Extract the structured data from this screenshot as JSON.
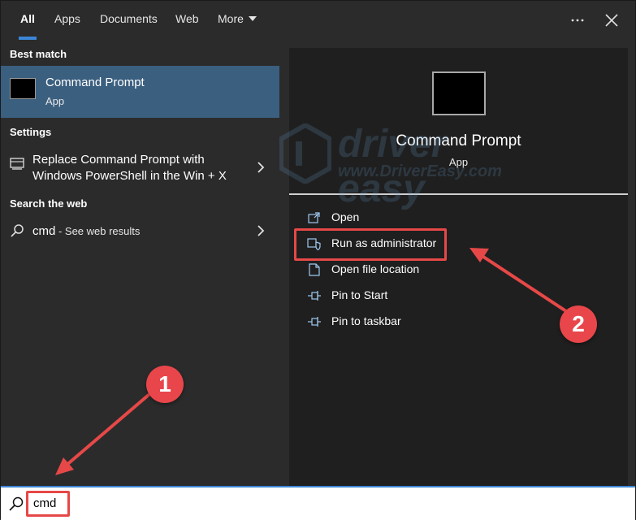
{
  "tabs": [
    {
      "label": "All",
      "active": true
    },
    {
      "label": "Apps"
    },
    {
      "label": "Documents"
    },
    {
      "label": "Web"
    },
    {
      "label": "More"
    }
  ],
  "top_icons": {
    "more": "ellipsis-icon",
    "close": "close-icon"
  },
  "left": {
    "best_match_heading": "Best match",
    "best_match": {
      "title": "Command Prompt",
      "subtitle": "App"
    },
    "settings_heading": "Settings",
    "settings_item": {
      "line1": "Replace Command Prompt with",
      "line2": "Windows PowerShell in the Win + X"
    },
    "web_heading": "Search the web",
    "web_item": {
      "query": "cmd",
      "suffix": " - See web results"
    }
  },
  "right": {
    "title": "Command Prompt",
    "subtitle": "App",
    "actions": [
      {
        "label": "Open",
        "icon": "open-icon"
      },
      {
        "label": "Run as administrator",
        "icon": "shield-icon"
      },
      {
        "label": "Open file location",
        "icon": "file-location-icon"
      },
      {
        "label": "Pin to Start",
        "icon": "pin-icon"
      },
      {
        "label": "Pin to taskbar",
        "icon": "pin-icon"
      }
    ]
  },
  "watermark": {
    "brand": "driver easy",
    "url": "www.DriverEasy.com"
  },
  "search": {
    "value": "cmd"
  },
  "annotations": {
    "badge1": "1",
    "badge2": "2",
    "color": "#e64848"
  }
}
